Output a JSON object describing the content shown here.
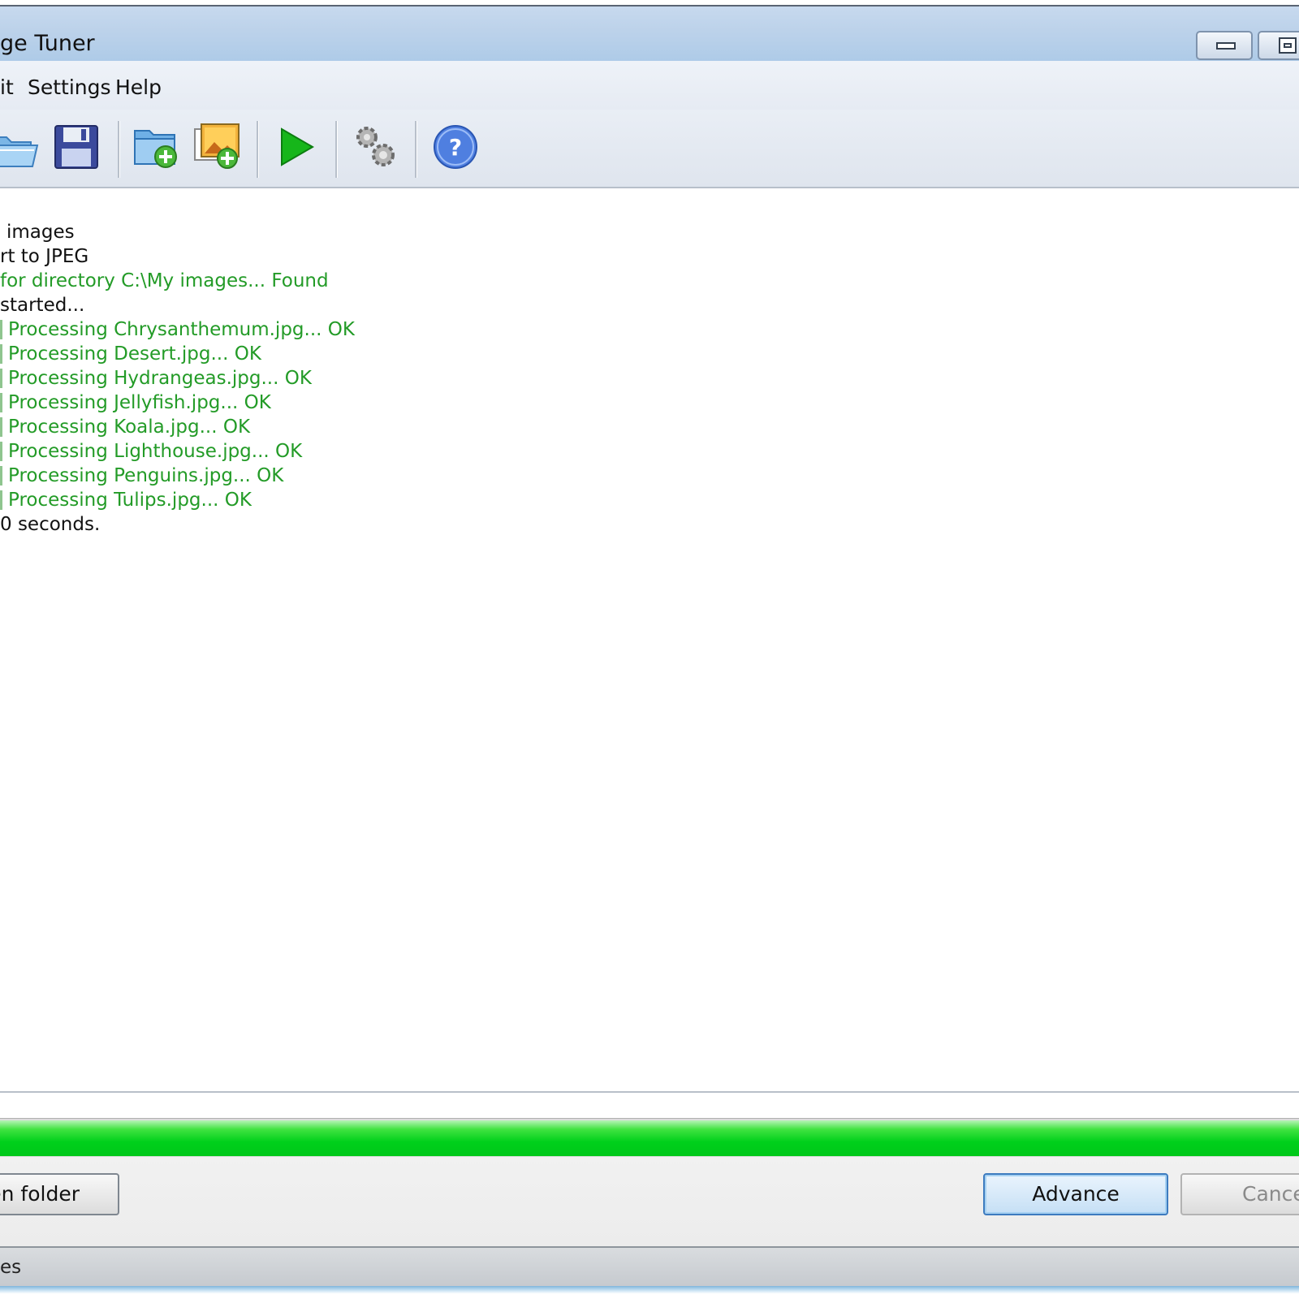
{
  "window": {
    "title": "ge Tuner"
  },
  "menu": {
    "items": [
      {
        "label": "it"
      },
      {
        "label": "Settings"
      },
      {
        "label": "Help"
      }
    ]
  },
  "toolbar": {
    "buttons": [
      {
        "icon": "open-folder-icon"
      },
      {
        "icon": "save-icon"
      },
      {
        "icon": "add-folder-icon"
      },
      {
        "icon": "add-images-icon"
      },
      {
        "icon": "run-icon"
      },
      {
        "icon": "settings-icon"
      },
      {
        "icon": "help-icon"
      }
    ]
  },
  "log": {
    "lines": [
      {
        "text": "images",
        "color": "black"
      },
      {
        "text": "rt to JPEG",
        "color": "black"
      },
      {
        "text": "for directory C:\\My images... Found",
        "color": "green"
      },
      {
        "text": "started...",
        "color": "black"
      },
      {
        "text": "Processing Chrysanthemum.jpg... OK",
        "color": "green"
      },
      {
        "text": "Processing Desert.jpg... OK",
        "color": "green"
      },
      {
        "text": "Processing Hydrangeas.jpg... OK",
        "color": "green"
      },
      {
        "text": "Processing Jellyfish.jpg... OK",
        "color": "green"
      },
      {
        "text": "Processing Koala.jpg... OK",
        "color": "green"
      },
      {
        "text": "Processing Lighthouse.jpg... OK",
        "color": "green"
      },
      {
        "text": "Processing Penguins.jpg... OK",
        "color": "green"
      },
      {
        "text": "Processing Tulips.jpg... OK",
        "color": "green"
      },
      {
        "text": "0 seconds.",
        "color": "black"
      }
    ]
  },
  "progress": {
    "percent": 100,
    "color": "#00d01b"
  },
  "buttons": {
    "open_folder": "en folder",
    "advance": "Advance",
    "cancel": "Cance"
  },
  "status": {
    "text": "es"
  },
  "colors": {
    "log_green": "#239b27",
    "titlebar": "#bcd2ea"
  }
}
